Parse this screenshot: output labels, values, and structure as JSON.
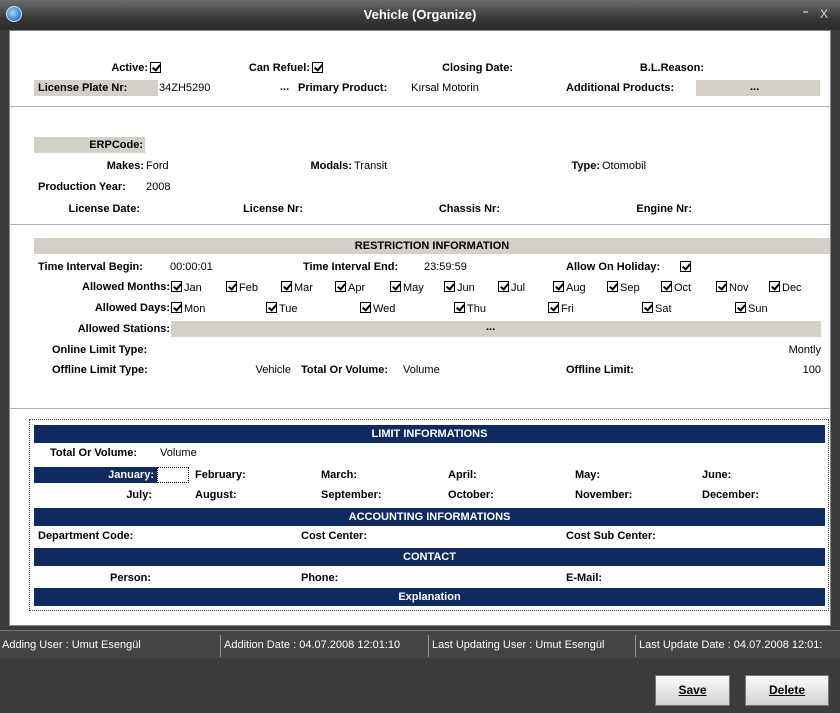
{
  "window": {
    "title": "Vehicle (Organize)",
    "controls": "⁼ X"
  },
  "general": {
    "active_label": "Active:",
    "can_refuel_label": "Can Refuel:",
    "closing_date_label": "Closing Date:",
    "bl_reason_label": "B.L.Reason:",
    "license_plate_label": "License Plate Nr:",
    "license_plate_value": "34ZH5290",
    "ellipsis": "...",
    "primary_product_label": "Primary Product:",
    "primary_product_value": "Kırsal Motorin",
    "additional_products_label": "Additional Products:"
  },
  "vehicle": {
    "erp_label": "ERPCode:",
    "makes_label": "Makes:",
    "makes_value": "Ford",
    "modals_label": "Modals:",
    "modals_value": "Transit",
    "type_label": "Type:",
    "type_value": "Otomobil",
    "prod_year_label": "Production Year:",
    "prod_year_value": "2008",
    "license_date_label": "License Date:",
    "license_nr_label": "License Nr:",
    "chassis_label": "Chassis Nr:",
    "engine_label": "Engine Nr:"
  },
  "restriction": {
    "header": "RESTRICTION INFORMATION",
    "tib_label": "Time Interval Begin:",
    "tib_value": "00:00:01",
    "tie_label": "Time Interval End:",
    "tie_value": "23:59:59",
    "holiday_label": "Allow On Holiday:",
    "months_label": "Allowed Months:",
    "months": [
      "Jan",
      "Feb",
      "Mar",
      "Apr",
      "May",
      "Jun",
      "Jul",
      "Aug",
      "Sep",
      "Oct",
      "Nov",
      "Dec"
    ],
    "days_label": "Allowed Days:",
    "days": [
      "Mon",
      "Tue",
      "Wed",
      "Thu",
      "Fri",
      "Sat",
      "Sun"
    ],
    "stations_label": "Allowed Stations:",
    "online_label": "Online Limit Type:",
    "online_value": "Montly",
    "offline_label": "Offline Limit Type:",
    "offline_value": "Vehicle",
    "tov_label": "Total Or Volume:",
    "tov_value": "Volume",
    "offline_limit_label": "Offline Limit:",
    "offline_limit_value": "100"
  },
  "limits": {
    "header": "LIMIT INFORMATIONS",
    "tov_label": "Total Or Volume:",
    "tov_value": "Volume",
    "months_row1": [
      "January:",
      "February:",
      "March:",
      "April:",
      "May:",
      "June:"
    ],
    "months_row2": [
      "July:",
      "August:",
      "September:",
      "October:",
      "November:",
      "December:"
    ]
  },
  "accounting": {
    "header": "ACCOUNTING INFORMATIONS",
    "dept_label": "Department Code:",
    "cost_center_label": "Cost Center:",
    "cost_sub_label": "Cost Sub Center:"
  },
  "contact": {
    "header": "CONTACT",
    "person_label": "Person:",
    "phone_label": "Phone:",
    "email_label": "E-Mail:"
  },
  "explanation": {
    "header": "Explanation"
  },
  "status": {
    "adding_user": "Adding User : Umut Esengül",
    "addition_date": "Addition Date : 04.07.2008 12:01:10",
    "last_updating_user": "Last Updating User : Umut Esengül",
    "last_update_date": "Last Update Date : 04.07.2008 12:01:"
  },
  "buttons": {
    "save": "Save",
    "delete": "Delete"
  }
}
